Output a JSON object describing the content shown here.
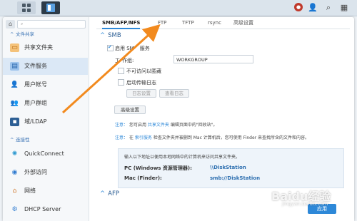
{
  "topbar": {
    "message_badge": "💬",
    "icons": [
      "grid-icon",
      "app-icon",
      "chat-icon",
      "user-icon",
      "search-icon",
      "menu-icon"
    ]
  },
  "sidebar": {
    "search_placeholder": "",
    "section_file_sharing": "文件共享",
    "section_connectivity": "连接性",
    "items": [
      {
        "label": "共享文件夹",
        "icon": "folder-icon",
        "color": "#e08a2a"
      },
      {
        "label": "文件服务",
        "icon": "file-services-icon",
        "color": "#2f7bd0"
      },
      {
        "label": "用户帐号",
        "icon": "user-icon",
        "color": "#3c7fc7"
      },
      {
        "label": "用户群组",
        "icon": "group-icon",
        "color": "#3c7fc7"
      },
      {
        "label": "域/LDAP",
        "icon": "ldap-icon",
        "color": "#3c7fc7"
      },
      {
        "label": "QuickConnect",
        "icon": "quickconnect-icon",
        "color": "#2f9ad0"
      },
      {
        "label": "外部访问",
        "icon": "globe-icon",
        "color": "#2f7bd0"
      },
      {
        "label": "网络",
        "icon": "network-icon",
        "color": "#d07a2f"
      },
      {
        "label": "DHCP Server",
        "icon": "dhcp-icon",
        "color": "#2f7bd0"
      }
    ]
  },
  "tabs": [
    "SMB/AFP/NFS",
    "FTP",
    "TFTP",
    "rsync",
    "高级设置"
  ],
  "smb": {
    "title": "SMB",
    "enable_label_a": "启用 SM",
    "enable_label_b": "服务",
    "workgroup_label_a": "工",
    "workgroup_label_b": "作组:",
    "workgroup_value": "WORKGROUP",
    "hide_label": "不可访问以匿藏",
    "log_label": "启动传输日志",
    "log_settings_btn": "日志设置",
    "view_log_btn": "查看日志",
    "advanced_btn": "高级设置",
    "note1_prefix": "注意：",
    "note1_a": "您可启用",
    "note1_link": "共享文件夹",
    "note1_b": "编辑页面中的\"回收站\"。",
    "note2_prefix": "注意：",
    "note2_a": "在",
    "note2_link": "索引服务",
    "note2_b": "检查文件夹并被删到 Mac 计算机后，您可使用 Finder 来查找所含的文件和内容。",
    "info_header": "输入以下地址以便用本地网络中的计算机来访问共享文件夹。",
    "pc_label": "PC (Windows 资源管理器):",
    "pc_value": "\\\\DiskStation",
    "mac_label": "Mac (Finder):",
    "mac_value": "smb://DiskStation"
  },
  "afp": {
    "title": "AFP"
  },
  "apply_btn": "应用",
  "watermark": "Baidu经验",
  "watermark_sub": "jingyan.baidu.com"
}
